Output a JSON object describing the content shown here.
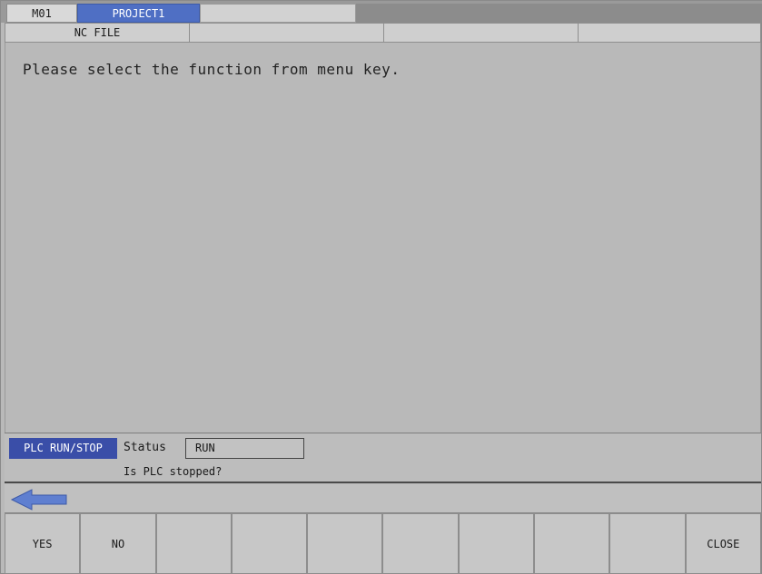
{
  "tabs": {
    "machine": "M01",
    "project": "PROJECT1",
    "blank": ""
  },
  "subtabs": [
    "NC FILE",
    "",
    "",
    ""
  ],
  "main": {
    "message": "Please select the function from menu key."
  },
  "status_panel": {
    "title": "PLC RUN/STOP",
    "status_label": "Status",
    "status_value": "RUN",
    "question": "Is PLC stopped?"
  },
  "nav": {
    "back_icon": "left-arrow-icon"
  },
  "function_keys": [
    "YES",
    "NO",
    "",
    "",
    "",
    "",
    "",
    "",
    "",
    "CLOSE"
  ],
  "colors": {
    "accent": "#3a4ea8",
    "tab_active": "#4f6fc4",
    "panel": "#b9b9b9"
  }
}
